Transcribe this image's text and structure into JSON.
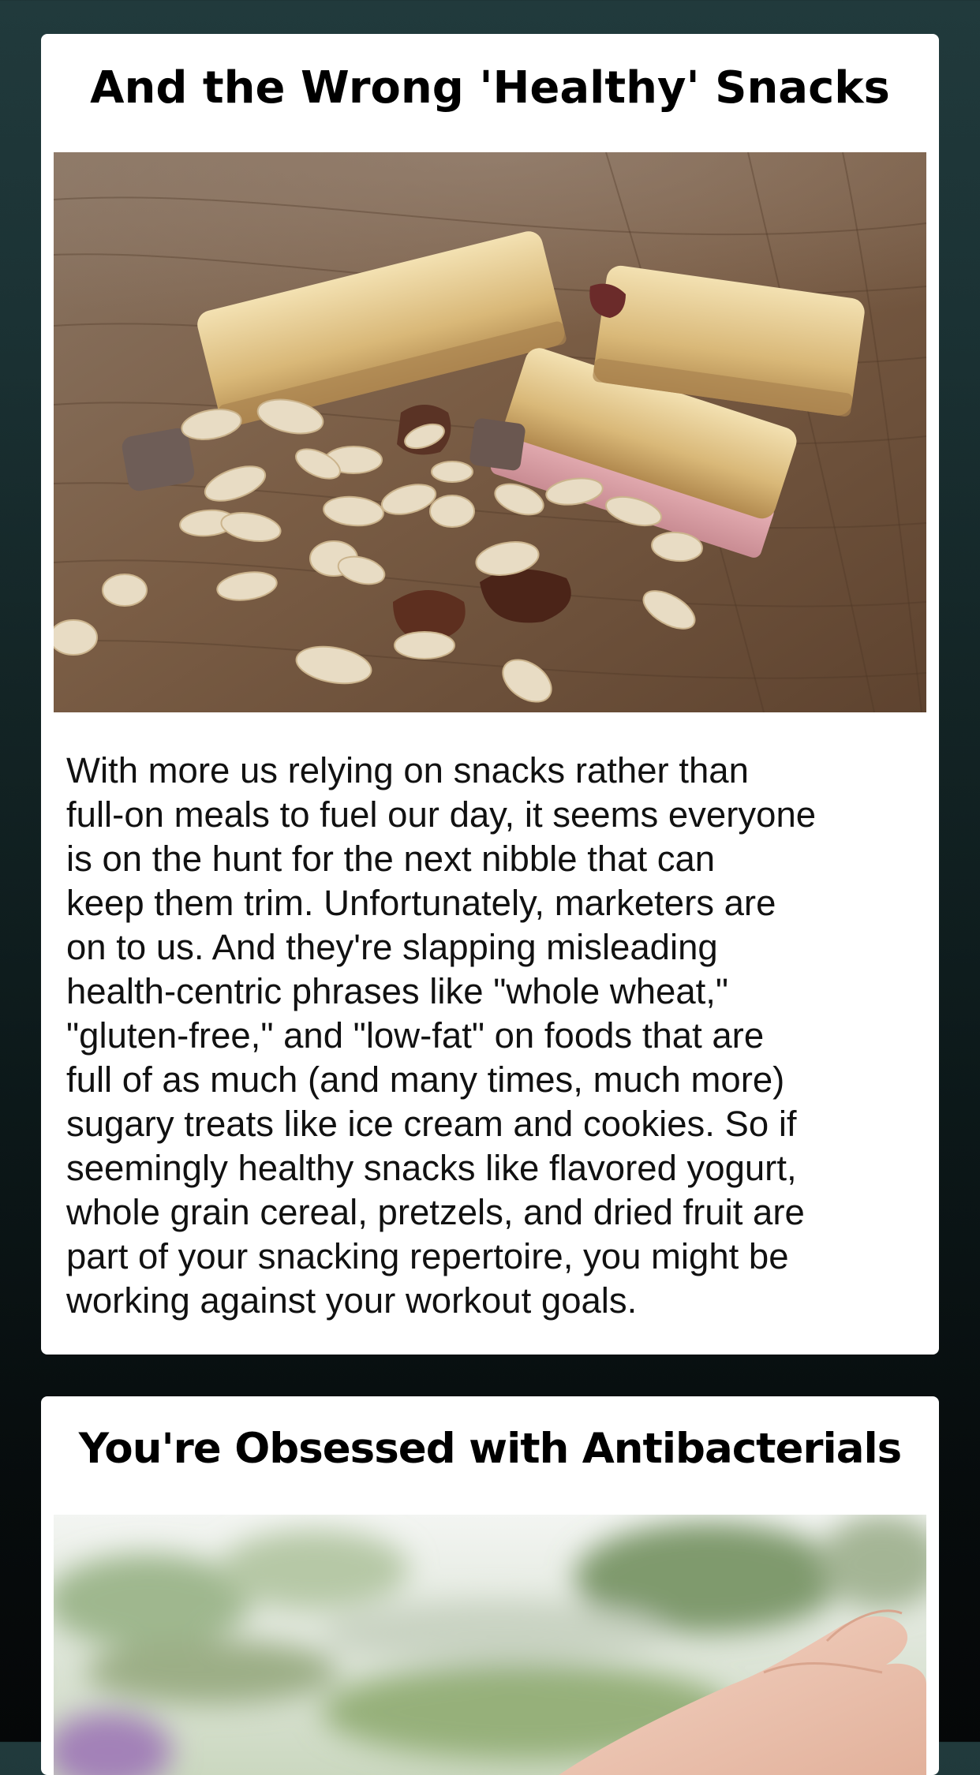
{
  "cards": [
    {
      "title": "And the Wrong 'Healthy' Snacks",
      "image_subject": "granola bars on a wooden table",
      "body_lines": [
        "With more us relying on snacks rather than",
        "full-on meals to fuel our day, it seems everyone",
        "is on the hunt for the next nibble that can",
        "keep them trim. Unfortunately, marketers are",
        "on to us. And they're slapping misleading",
        "health-centric phrases like \"whole wheat,\"",
        "\"gluten-free,\" and \"low-fat\" on foods that are",
        "full of as much (and many times, much more)",
        "sugary treats like ice cream and cookies. So if",
        "seemingly healthy snacks like flavored yogurt,",
        "whole grain cereal, pretzels, and dried fruit are",
        "part of your snacking repertoire, you might be",
        "working against your workout goals."
      ]
    },
    {
      "title": "You're Obsessed with Antibacterials",
      "image_subject": "hand reaching out against a blurred green background"
    }
  ],
  "colors": {
    "background_top": "#213a3c",
    "background_bottom": "#050708",
    "card": "#ffffff",
    "text": "#111111"
  }
}
